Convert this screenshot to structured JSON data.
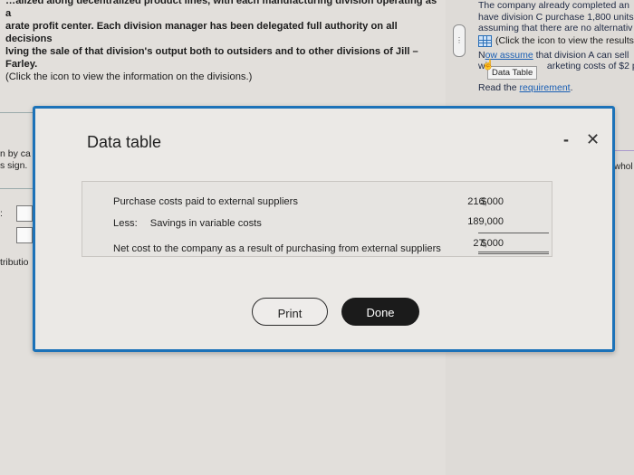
{
  "problem_text": {
    "line0": "…alized along decentralized product lines, with each manufacturing division operating as a",
    "line1": "arate profit center. Each division manager has been delegated full authority on all decisions",
    "line2": "lving the sale of that division's output both to outsiders and to other divisions of Jill – Farley.",
    "line3": "(Click the icon to view the information on the divisions.)"
  },
  "right_panel": {
    "line0": "The company already completed an",
    "line1": "have division C purchase 1,800 units",
    "line2": "assuming that there are no alternativ",
    "click_text": "(Click the icon to view the results",
    "assume_prefix": "N",
    "assume_link": "ow assume",
    "assume_suffix": " that division A can sell",
    "line5_prefix": "wi",
    "line5_suffix": "arketing costs of $2 p",
    "read_prefix": "Read the ",
    "read_link": "requirement",
    "read_suffix": ".",
    "tooltip": "Data Table"
  },
  "left_stubs": {
    "stub1": "n by ca",
    "stub2": "s sign.",
    "stub3": ":",
    "stub4": "tributio"
  },
  "right_stub": "whol",
  "modal": {
    "title": "Data table",
    "minimize": "-",
    "close": "✕",
    "rows": [
      {
        "label": "Purchase costs paid to external suppliers",
        "currency": "$",
        "amount": "216,000"
      },
      {
        "prefix": "Less:",
        "label": "Savings in variable costs",
        "currency": "",
        "amount": "189,000"
      },
      {
        "label": "Net cost to the company as a result of purchasing from external suppliers",
        "currency": "$",
        "amount": "27,000"
      }
    ],
    "print_label": "Print",
    "done_label": "Done"
  }
}
